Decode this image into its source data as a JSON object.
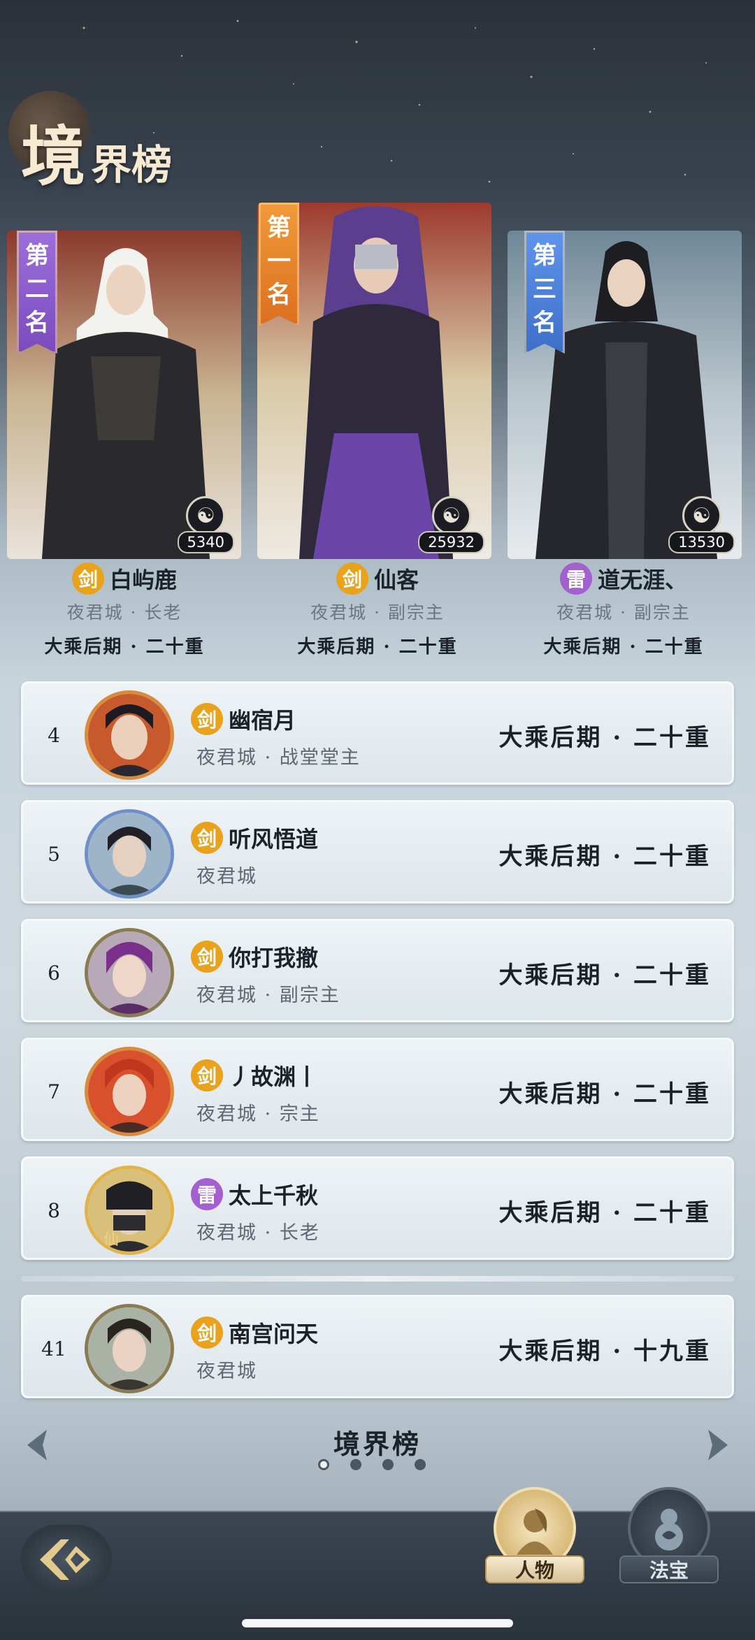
{
  "page": {
    "title_big": "境",
    "title_small": "界榜"
  },
  "colors": {
    "sword": "#e8a21c",
    "thunder": "#a45fd0",
    "rank1": "#e7822a",
    "rank2": "#8e5ccf",
    "rank3": "#4b7fd6"
  },
  "podium": [
    {
      "banner": [
        "第",
        "二",
        "名"
      ],
      "score": "5340",
      "element": "剑",
      "name": "白屿鹿",
      "guild": "夜君城 · 长老",
      "realm": "大乘后期 · 二十重"
    },
    {
      "banner": [
        "第",
        "一",
        "名"
      ],
      "score": "25932",
      "element": "剑",
      "name": "仙客",
      "guild": "夜君城 · 副宗主",
      "realm": "大乘后期 · 二十重"
    },
    {
      "banner": [
        "第",
        "三",
        "名"
      ],
      "score": "13530",
      "element": "雷",
      "name": "道无涯、",
      "guild": "夜君城 · 副宗主",
      "realm": "大乘后期 · 二十重"
    }
  ],
  "rows": [
    {
      "rank": "4",
      "element": "剑",
      "name": "幽宿月",
      "guild": "夜君城 · 战堂堂主",
      "realm": "大乘后期 · 二十重"
    },
    {
      "rank": "5",
      "element": "剑",
      "name": "听风悟道",
      "guild": "夜君城",
      "realm": "大乘后期 · 二十重"
    },
    {
      "rank": "6",
      "element": "剑",
      "name": "你打我撤",
      "guild": "夜君城 · 副宗主",
      "realm": "大乘后期 · 二十重"
    },
    {
      "rank": "7",
      "element": "剑",
      "name": "丿故渊丨",
      "guild": "夜君城 · 宗主",
      "realm": "大乘后期 · 二十重"
    },
    {
      "rank": "8",
      "element": "雷",
      "name": "太上千秋",
      "guild": "夜君城 · 长老",
      "realm": "大乘后期 · 二十重",
      "avatar_tag": "仙"
    },
    {
      "rank": "41",
      "element": "剑",
      "name": "南宫问天",
      "guild": "夜君城",
      "realm": "大乘后期 · 十九重"
    }
  ],
  "pager": {
    "title": "境界榜",
    "page_count": 4,
    "active_page": 1
  },
  "tabs": {
    "character": "人物",
    "treasure": "法宝"
  }
}
